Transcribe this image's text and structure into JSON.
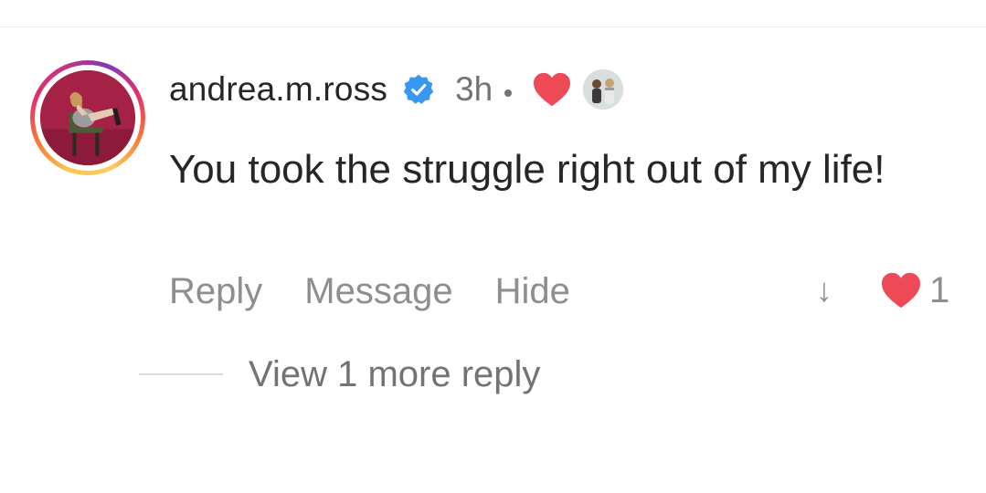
{
  "comment": {
    "username": "andrea.m.ross",
    "verified": true,
    "time_ago": "3h",
    "liked_by_creator": true,
    "text": "You took the struggle right out of my life!"
  },
  "actions": {
    "reply": "Reply",
    "message": "Message",
    "hide": "Hide"
  },
  "likes": {
    "count": "1",
    "liked": true
  },
  "replies": {
    "view_more_label": "View 1 more reply"
  },
  "colors": {
    "heart": "#ed4956",
    "verified_badge": "#3897f0",
    "text_primary": "#262626",
    "text_secondary": "#8e8e8e"
  },
  "icons": {
    "verified": "verified-badge-icon",
    "creator_like": "heart-filled-icon",
    "sort": "arrow-down-icon",
    "like": "heart-filled-icon"
  }
}
